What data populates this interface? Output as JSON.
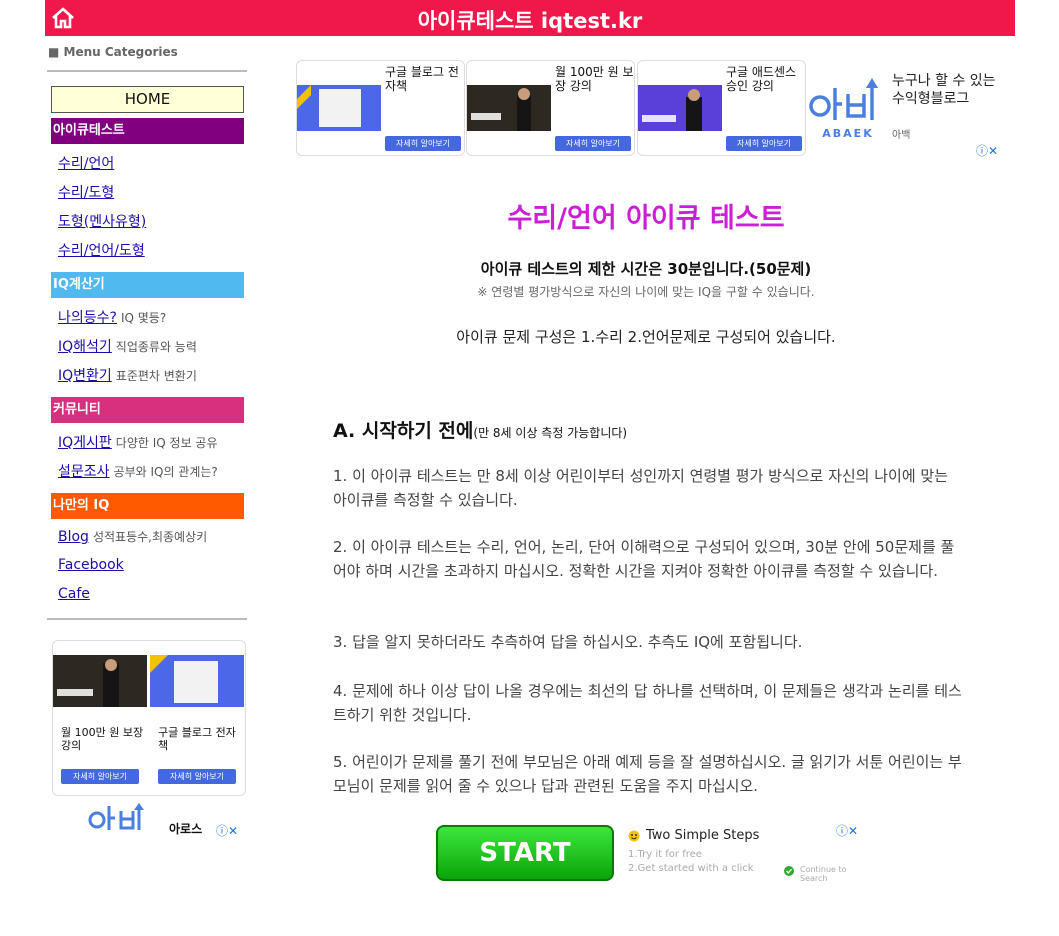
{
  "header": {
    "title": "아이큐테스트 iqtest.kr",
    "bg": "#f0184b"
  },
  "sidebar": {
    "menu_categories": "■ Menu Categories",
    "home": "HOME",
    "sections": [
      {
        "title": "아이큐테스트",
        "color": "#800080",
        "items": [
          {
            "label": "수리/언어",
            "sub": ""
          },
          {
            "label": "수리/도형",
            "sub": ""
          },
          {
            "label": "도형(멘사유형)",
            "sub": ""
          },
          {
            "label": "수리/언어/도형",
            "sub": ""
          }
        ]
      },
      {
        "title": "IQ계산기",
        "color": "#4fb9f0",
        "items": [
          {
            "label": "나의등수?",
            "sub": "IQ 몇등?"
          },
          {
            "label": "IQ해석기",
            "sub": "직업종류와 능력"
          },
          {
            "label": "IQ변환기",
            "sub": "표준편차 변환기"
          }
        ]
      },
      {
        "title": "커뮤니티",
        "color": "#d8307e",
        "items": [
          {
            "label": "IQ게시판",
            "sub": "다양한 IQ 정보 공유"
          },
          {
            "label": "설문조사",
            "sub": "공부와 IQ의 관계는?"
          }
        ]
      },
      {
        "title": "나만의 IQ",
        "color": "#ff5a00",
        "items": [
          {
            "label": "Blog",
            "sub": "성적표등수,최종예상키"
          },
          {
            "label": "Facebook",
            "sub": ""
          },
          {
            "label": "Cafe",
            "sub": ""
          }
        ]
      }
    ],
    "ad": {
      "cards": [
        {
          "text": "월 100만 원 보장 강의",
          "button": "자세히 알아보기"
        },
        {
          "text": "구글 블로그 전자책",
          "button": "자세히 알아보기"
        }
      ],
      "brand": "아백",
      "brand2": "아로스",
      "choice": "ⓘ✕"
    }
  },
  "top_ad": {
    "cards": [
      {
        "text": "구글 블로그 전자책",
        "button": "자세히 알아보기"
      },
      {
        "text": "월 100만 원 보장 강의",
        "button": "자세히 알아보기"
      },
      {
        "text": "구글 애드센스 승인 강의",
        "button": "자세히 알아보기"
      }
    ],
    "brand_text": "아백",
    "brand_en": "ABAEK",
    "tagline": "누구나 할 수 있는 수익형블로그",
    "brand_sub": "아백",
    "choice": "ⓘ✕"
  },
  "main": {
    "title": "수리/언어 아이큐 테스트",
    "limit": "아이큐 테스트의 제한 시간은 30분입니다.(50문제)",
    "limit_note": "※ 연령별 평가방식으로 자신의 나이에 맞는 IQ을 구할 수 있습니다.",
    "composition": "아이큐 문제 구성은 1.수리 2.언어문제로 구성되어 있습니다.",
    "section_a_title": "A. 시작하기 전에",
    "section_a_note": "(만 8세 이상 측정 가능합니다)",
    "paragraphs": [
      "1. 이 아이큐 테스트는 만 8세 이상 어린이부터 성인까지 연령별 평가 방식으로 자신의 나이에 맞는 아이큐를 측정할 수 있습니다.",
      "2. 이 아이큐 테스트는 수리, 언어, 논리, 단어 이해력으로 구성되어 있으며, 30분 안에 50문제를 풀어야 하며 시간을 초과하지 마십시오. 정확한 시간을 지켜야 정확한 아이큐를 측정할 수 있습니다.",
      "3. 답을 알지 못하더라도 추측하여 답을 하십시오. 추측도 IQ에 포함됩니다.",
      "4. 문제에 하나 이상 답이 나올 경우에는 최선의 답 하나를 선택하며, 이 문제들은 생각과 논리를 테스트하기 위한 것입니다.",
      "5. 어린이가 문제를 풀기 전에 부모님은 아래 예제 등을 잘 설명하십시오. 글 읽기가 서툰 어린이는 부모님이 문제를 읽어 줄 수 있으나 답과 관련된 도움을 주지 마십시오."
    ]
  },
  "bottom_ad": {
    "button": "START",
    "title": "Two Simple Steps",
    "step1": "1.Try it for free",
    "step2": "2.Get started with a click",
    "continue": "Continue to Search",
    "choice": "ⓘ✕"
  }
}
